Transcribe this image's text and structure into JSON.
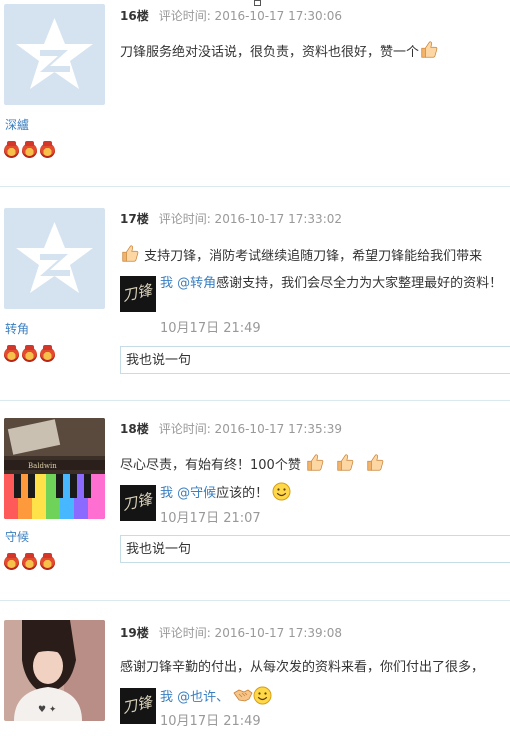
{
  "comments": [
    {
      "username": "深纑",
      "floor": "16楼",
      "time": "评论时间: 2016-10-17 17:30:06",
      "content": "刀锋服务绝对没话说，很负责，资料也很好，赞一个"
    },
    {
      "username": "转角",
      "floor": "17楼",
      "time": "评论时间: 2016-10-17 17:33:02",
      "content": "支持刀锋，消防考试继续追随刀锋，希望刀锋能给我们带来",
      "reply": {
        "me": "我",
        "mention": "@转角",
        "text": "感谢支持，我们会尽全力为大家整理最好的资料！",
        "time": "10月17日 21:49",
        "avatar_text": "刀锋"
      },
      "say_box": "我也说一句"
    },
    {
      "username": "守候",
      "floor": "18楼",
      "time": "评论时间: 2016-10-17 17:35:39",
      "content": "尽心尽责，有始有终！100个赞",
      "reply": {
        "me": "我",
        "mention": "@守候",
        "text": "应该的！",
        "time": "10月17日 21:07",
        "avatar_text": "刀锋"
      },
      "say_box": "我也说一句",
      "avatar_brand": "Baldwin"
    },
    {
      "username": "",
      "floor": "19楼",
      "time": "评论时间: 2016-10-17 17:39:08",
      "content": "感谢刀锋辛勤的付出，从每次发的资料来看，你们付出了很多，",
      "reply": {
        "me": "我",
        "mention": "@也许、",
        "text": "",
        "time": "10月17日 21:49",
        "avatar_text": "刀锋"
      }
    }
  ],
  "colors": {
    "link": "#3a7fc1",
    "meta": "#999999",
    "separator": "#d9e9ee",
    "input_border": "#c6dde6"
  }
}
